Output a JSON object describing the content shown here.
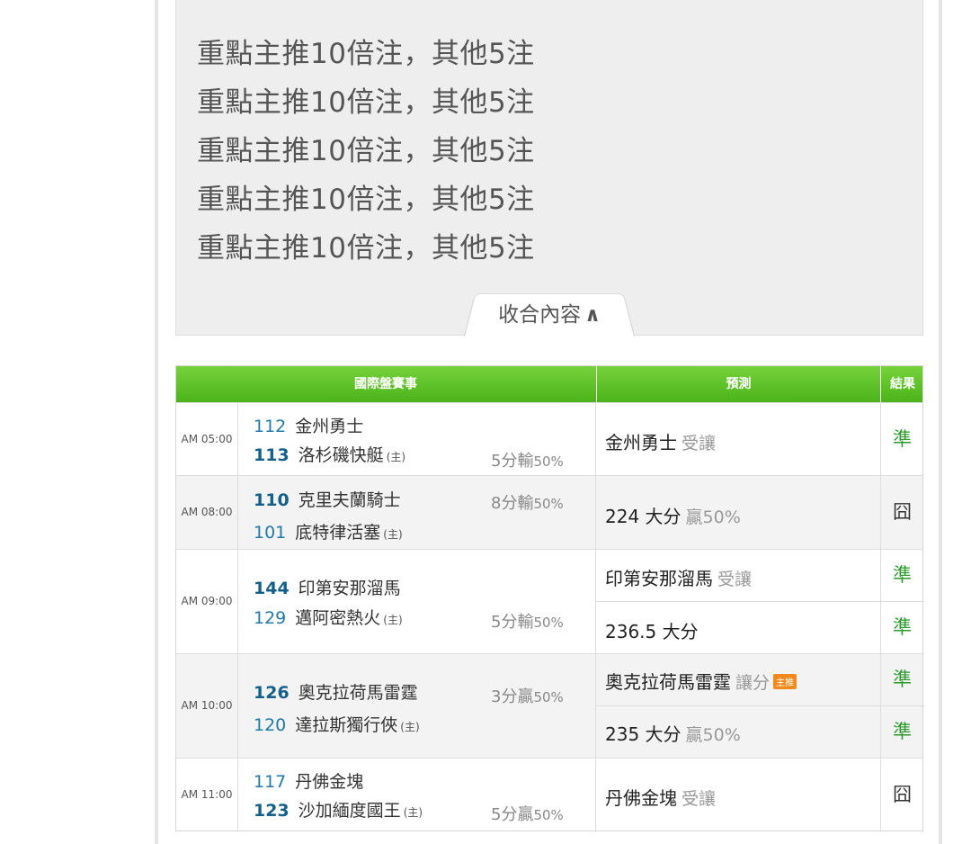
{
  "notes": [
    "重點主推10倍注，其他5注",
    "重點主推10倍注，其他5注",
    "重點主推10倍注，其他5注",
    "重點主推10倍注，其他5注",
    "重點主推10倍注，其他5注"
  ],
  "collapse_label": "收合內容",
  "table": {
    "headers": {
      "event": "國際盤賽事",
      "prediction": "預測",
      "result": "結果"
    },
    "games": [
      {
        "time": "AM 05:00",
        "team1_num": "112",
        "team1": "金州勇士",
        "team2_num": "113",
        "team2": "洛杉磯快艇",
        "home_mark": "(主)",
        "odds": "5分輸",
        "odds_pct": "50%",
        "pred1": "金州勇士",
        "pred1_note": "受讓",
        "res1": "準"
      },
      {
        "time": "AM 08:00",
        "team1_num": "110",
        "team1": "克里夫蘭騎士",
        "team2_num": "101",
        "team2": "底特律活塞",
        "home_mark": "(主)",
        "odds": "8分輸",
        "odds_pct": "50%",
        "pred1": "224 大分",
        "pred1_note": "贏50%",
        "res1": "囧"
      },
      {
        "time": "AM 09:00",
        "team1_num": "144",
        "team1": "印第安那溜馬",
        "team2_num": "129",
        "team2": "邁阿密熱火",
        "home_mark": "(主)",
        "odds": "5分輸",
        "odds_pct": "50%",
        "pred1": "印第安那溜馬",
        "pred1_note": "受讓",
        "res1": "準",
        "pred2": "236.5 大分",
        "res2": "準"
      },
      {
        "time": "AM 10:00",
        "team1_num": "126",
        "team1": "奧克拉荷馬雷霆",
        "team2_num": "120",
        "team2": "達拉斯獨行俠",
        "home_mark": "(主)",
        "odds": "3分贏",
        "odds_pct": "50%",
        "pred1": "奧克拉荷馬雷霆",
        "pred1_note": "讓分",
        "badge": "主推",
        "res1": "準",
        "pred2": "235 大分",
        "pred2_note": "贏50%",
        "res2": "準"
      },
      {
        "time": "AM 11:00",
        "team1_num": "117",
        "team1": "丹佛金塊",
        "team2_num": "123",
        "team2": "沙加緬度國王",
        "home_mark": "(主)",
        "odds": "5分贏",
        "odds_pct": "50%",
        "pred1": "丹佛金塊",
        "pred1_note": "受讓",
        "res1": "囧"
      }
    ]
  }
}
